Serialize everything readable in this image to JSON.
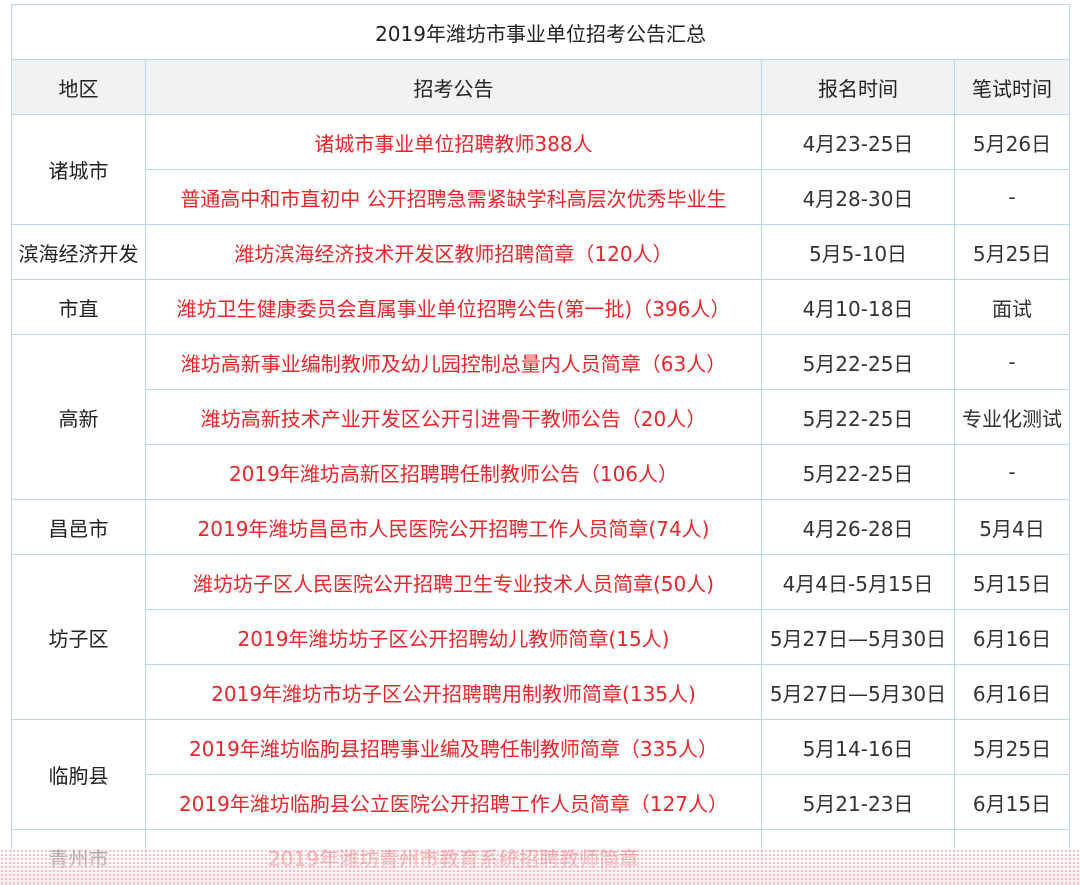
{
  "table": {
    "title": "2019年潍坊市事业单位招考公告汇总",
    "headers": {
      "region": "地区",
      "notice": "招考公告",
      "registration": "报名时间",
      "exam": "笔试时间"
    },
    "groups": [
      {
        "region": "诸城市",
        "rows": [
          {
            "notice": "诸城市事业单位招聘教师388人",
            "registration": "4月23-25日",
            "exam": "5月26日"
          },
          {
            "notice": "普通高中和市直初中 公开招聘急需紧缺学科高层次优秀毕业生",
            "registration": "4月28-30日",
            "exam": "-"
          }
        ]
      },
      {
        "region": "滨海经济开发",
        "rows": [
          {
            "notice": "潍坊滨海经济技术开发区教师招聘简章（120人）",
            "registration": "5月5-10日",
            "exam": "5月25日"
          }
        ]
      },
      {
        "region": "市直",
        "rows": [
          {
            "notice": "潍坊卫生健康委员会直属事业单位招聘公告(第一批)（396人）",
            "registration": "4月10-18日",
            "exam": "面试"
          }
        ]
      },
      {
        "region": "高新",
        "rows": [
          {
            "notice": "潍坊高新事业编制教师及幼儿园控制总量内人员简章（63人）",
            "registration": "5月22-25日",
            "exam": "-"
          },
          {
            "notice": "潍坊高新技术产业开发区公开引进骨干教师公告（20人）",
            "registration": "5月22-25日",
            "exam": "专业化测试"
          },
          {
            "notice": "2019年潍坊高新区招聘聘任制教师公告（106人）",
            "registration": "5月22-25日",
            "exam": "-"
          }
        ]
      },
      {
        "region": "昌邑市",
        "rows": [
          {
            "notice": "2019年潍坊昌邑市人民医院公开招聘工作人员简章(74人)",
            "registration": "4月26-28日",
            "exam": "5月4日"
          }
        ]
      },
      {
        "region": "坊子区",
        "rows": [
          {
            "notice": "潍坊坊子区人民医院公开招聘卫生专业技术人员简章(50人)",
            "registration": "4月4日-5月15日",
            "exam": "5月15日"
          },
          {
            "notice": "2019年潍坊坊子区公开招聘幼儿教师简章(15人)",
            "registration": "5月27日—5月30日",
            "exam": "6月16日"
          },
          {
            "notice": "2019年潍坊市坊子区公开招聘聘用制教师简章(135人)",
            "registration": "5月27日—5月30日",
            "exam": "6月16日"
          }
        ]
      },
      {
        "region": "临朐县",
        "rows": [
          {
            "notice": "2019年潍坊临朐县招聘事业编及聘任制教师简章（335人）",
            "registration": "5月14-16日",
            "exam": "5月25日"
          },
          {
            "notice": "2019年潍坊临朐县公立医院公开招聘工作人员简章（127人）",
            "registration": "5月21-23日",
            "exam": "6月15日"
          }
        ]
      },
      {
        "region": "青州市",
        "rows": [
          {
            "notice": "2019年潍坊青州市教育系统招聘教师简章",
            "registration": "",
            "exam": ""
          }
        ]
      }
    ]
  },
  "colors": {
    "border": "#b7d7ef",
    "header_bg": "#f2f2f2",
    "link_red": "#e8262b"
  }
}
